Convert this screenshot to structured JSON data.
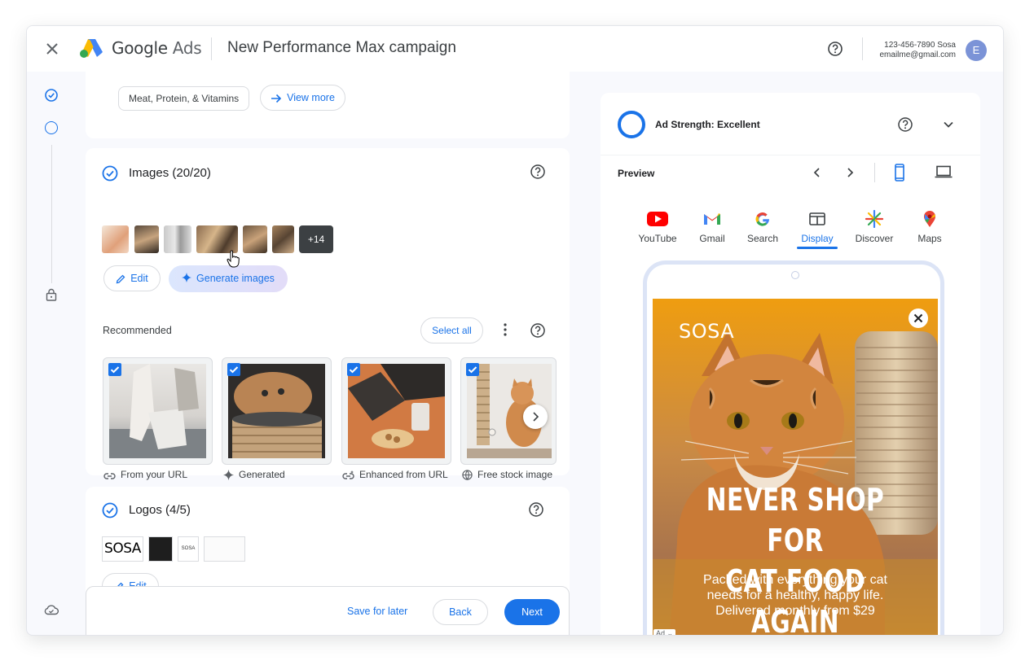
{
  "header": {
    "brand_google": "Google",
    "brand_ads": "Ads",
    "campaign_title": "New Performance Max campaign",
    "account_phone": "123-456-7890 Sosa",
    "account_email": "emailme@gmail.com",
    "avatar_initial": "E"
  },
  "top_card": {
    "chip_label": "Meat, Protein, & Vitamins",
    "view_more_label": "View more"
  },
  "images_section": {
    "title": "Images (20/20)",
    "more_count": "+14",
    "edit_label": "Edit",
    "generate_label": "Generate images",
    "recommended_label": "Recommended",
    "select_all_label": "Select all",
    "recommended": [
      {
        "caption": "From your URL",
        "icon": "link-icon",
        "checked": true
      },
      {
        "caption": "Generated",
        "icon": "sparkle-icon",
        "checked": true
      },
      {
        "caption": "Enhanced from URL",
        "icon": "link-enhanced-icon",
        "checked": true
      },
      {
        "caption": "Free stock image",
        "icon": "globe-icon",
        "checked": true
      }
    ]
  },
  "logos_section": {
    "title": "Logos (4/5)",
    "logo_text_1": "SOSA",
    "logo_text_3": "SOSA",
    "edit_label": "Edit"
  },
  "footer": {
    "save_label": "Save for later",
    "back_label": "Back",
    "next_label": "Next"
  },
  "right_panel": {
    "ad_strength": "Ad Strength: Excellent",
    "preview_label": "Preview",
    "channels": [
      {
        "label": "YouTube",
        "icon": "youtube-icon",
        "active": false
      },
      {
        "label": "Gmail",
        "icon": "gmail-icon",
        "active": false
      },
      {
        "label": "Search",
        "icon": "google-icon",
        "active": false
      },
      {
        "label": "Display",
        "icon": "display-icon",
        "active": true
      },
      {
        "label": "Discover",
        "icon": "discover-icon",
        "active": false
      },
      {
        "label": "Maps",
        "icon": "maps-icon",
        "active": false
      }
    ],
    "ad": {
      "brand": "SOSA",
      "headline_1": "NEVER SHOP FOR",
      "headline_2": "CAT FOOD AGAIN",
      "body_1": "Packed with everything your cat",
      "body_2": "needs for a healthy, happy life.",
      "body_3": "Delivered monthly from $29",
      "tag": "Ad"
    }
  },
  "colors": {
    "accent": "#1a73e8",
    "ad_background": "#e69a18"
  }
}
